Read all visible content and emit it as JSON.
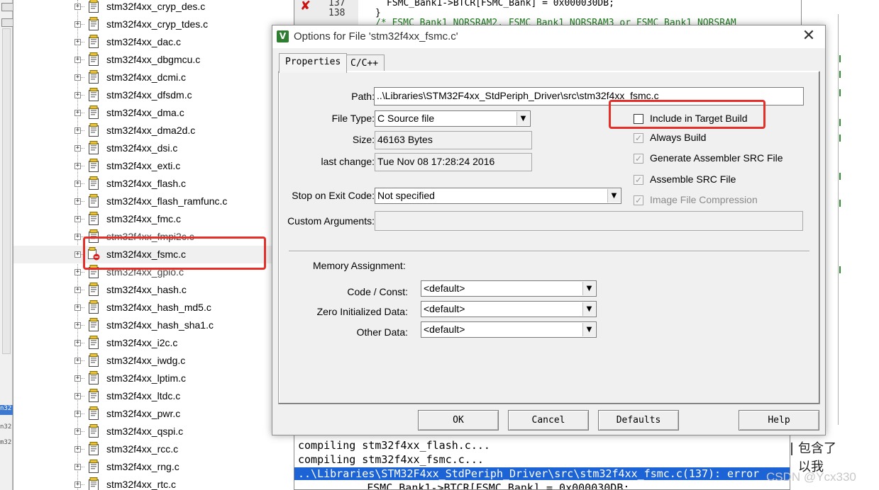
{
  "left_edge": {
    "mini_labels": [
      "n32",
      "n32",
      "m32"
    ]
  },
  "tree": {
    "expander_glyph": "+",
    "files": [
      "stm32f4xx_cryp_des.c",
      "stm32f4xx_cryp_tdes.c",
      "stm32f4xx_dac.c",
      "stm32f4xx_dbgmcu.c",
      "stm32f4xx_dcmi.c",
      "stm32f4xx_dfsdm.c",
      "stm32f4xx_dma.c",
      "stm32f4xx_dma2d.c",
      "stm32f4xx_dsi.c",
      "stm32f4xx_exti.c",
      "stm32f4xx_flash.c",
      "stm32f4xx_flash_ramfunc.c",
      "stm32f4xx_fmc.c",
      "stm32f4xx_fmpi2c.c",
      "stm32f4xx_fsmc.c",
      "stm32f4xx_gpio.c",
      "stm32f4xx_hash.c",
      "stm32f4xx_hash_md5.c",
      "stm32f4xx_hash_sha1.c",
      "stm32f4xx_i2c.c",
      "stm32f4xx_iwdg.c",
      "stm32f4xx_lptim.c",
      "stm32f4xx_ltdc.c",
      "stm32f4xx_pwr.c",
      "stm32f4xx_qspi.c",
      "stm32f4xx_rcc.c",
      "stm32f4xx_rng.c",
      "stm32f4xx_rtc.c"
    ]
  },
  "editor": {
    "line_137": "137",
    "line_138": "138",
    "code_137": "FSMC_Bank1->BTCR[FSMC_Bank] = 0x000030DB;",
    "code_138": "}",
    "code_139": "/* FSMC_Bank1_NORSRAM2, FSMC_Bank1_NORSRAM3 or FSMC_Bank1_NORSRAM"
  },
  "output": {
    "line1": "compiling stm32f4xx_flash.c...",
    "line2": "compiling stm32f4xx_fsmc.c...",
    "line3": "..\\Libraries\\STM32F4xx_StdPeriph_Driver\\src\\stm32f4xx_fsmc.c(137): error",
    "line4": "    FSMC_Bank1->BTCR[FSMC_Bank] = 0x000030DB;"
  },
  "background_note": "包含了\n以我",
  "watermark": "CSDN @Ycx330",
  "dialog": {
    "title": "Options for File 'stm32f4xx_fsmc.c'",
    "close_glyph": "✕",
    "tabs": {
      "properties": "Properties",
      "cpp": "C/C++"
    },
    "path": {
      "label": "Path:",
      "value": "..\\Libraries\\STM32F4xx_StdPeriph_Driver\\src\\stm32f4xx_fsmc.c"
    },
    "file_type": {
      "label": "File Type:",
      "value": "C Source file"
    },
    "size": {
      "label": "Size:",
      "value": "46163 Bytes"
    },
    "last_change": {
      "label": "last change:",
      "value": "Tue Nov 08 17:28:24 2016"
    },
    "stop_on_exit": {
      "label": "Stop on Exit Code:",
      "value": "Not specified"
    },
    "custom_args": {
      "label": "Custom Arguments:",
      "value": ""
    },
    "checkboxes": {
      "include_in_target": {
        "label": "Include in Target Build",
        "checked": false
      },
      "always_build": {
        "label": "Always Build",
        "checked": true
      },
      "gen_asm_src": {
        "label": "Generate Assembler SRC File",
        "checked": true
      },
      "assemble_src": {
        "label": "Assemble SRC File",
        "checked": true
      },
      "image_compression": {
        "label": "Image File Compression",
        "checked": true
      }
    },
    "memory": {
      "heading": "Memory Assignment:",
      "code_const": {
        "label": "Code / Const:",
        "value": "<default>"
      },
      "zero_init": {
        "label": "Zero Initialized Data:",
        "value": "<default>"
      },
      "other": {
        "label": "Other Data:",
        "value": "<default>"
      }
    },
    "buttons": {
      "ok": "OK",
      "cancel": "Cancel",
      "defaults": "Defaults",
      "help": "Help"
    }
  },
  "colors": {
    "annotation_red": "#e5302a",
    "selection_blue": "#1c63d6",
    "keil_green": "#2f7d31"
  }
}
